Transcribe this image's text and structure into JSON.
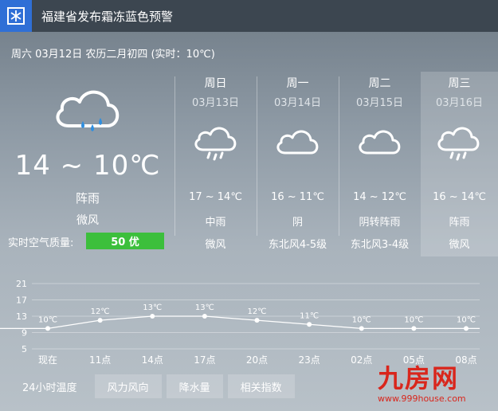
{
  "alert": {
    "text": "福建省发布霜冻蓝色预警",
    "icon": "frost-warning-icon",
    "icon_color": "#2f6fd6"
  },
  "date_line": "周六 03月12日 农历二月初四 (实时：10℃)",
  "today": {
    "icon": "showers-icon",
    "temp": "14 ~ 10℃",
    "condition": "阵雨",
    "wind": "微风",
    "aqi_label": "实时空气质量:",
    "aqi_value": "50 优",
    "aqi_color": "#3cbf3c"
  },
  "forecast": [
    {
      "day": "周日",
      "date": "03月13日",
      "icon": "showers-icon",
      "temp": "17 ~ 14℃",
      "condition": "中雨",
      "wind": "微风"
    },
    {
      "day": "周一",
      "date": "03月14日",
      "icon": "cloudy-icon",
      "temp": "16 ~ 11℃",
      "condition": "阴",
      "wind": "东北风4-5级"
    },
    {
      "day": "周二",
      "date": "03月15日",
      "icon": "cloudy-icon",
      "temp": "14 ~ 12℃",
      "condition": "阴转阵雨",
      "wind": "东北风3-4级"
    },
    {
      "day": "周三",
      "date": "03月16日",
      "icon": "showers-icon",
      "temp": "16 ~ 14℃",
      "condition": "阵雨",
      "wind": "微风"
    }
  ],
  "chart_data": {
    "type": "line",
    "categories": [
      "现在",
      "11点",
      "14点",
      "17点",
      "20点",
      "23点",
      "02点",
      "05点",
      "08点"
    ],
    "values": [
      10,
      12,
      13,
      13,
      12,
      11,
      10,
      10,
      10
    ],
    "point_labels": [
      "10℃",
      "12℃",
      "13℃",
      "13℃",
      "12℃",
      "11℃",
      "10℃",
      "10℃",
      "10℃"
    ],
    "yticks": [
      21,
      17,
      13,
      9,
      5
    ],
    "ylim": [
      5,
      21
    ],
    "grid": true
  },
  "tabs": [
    "24小时温度",
    "风力风向",
    "降水量",
    "相关指数"
  ],
  "watermark": {
    "big": "九房网",
    "small": "www.999house.com"
  }
}
